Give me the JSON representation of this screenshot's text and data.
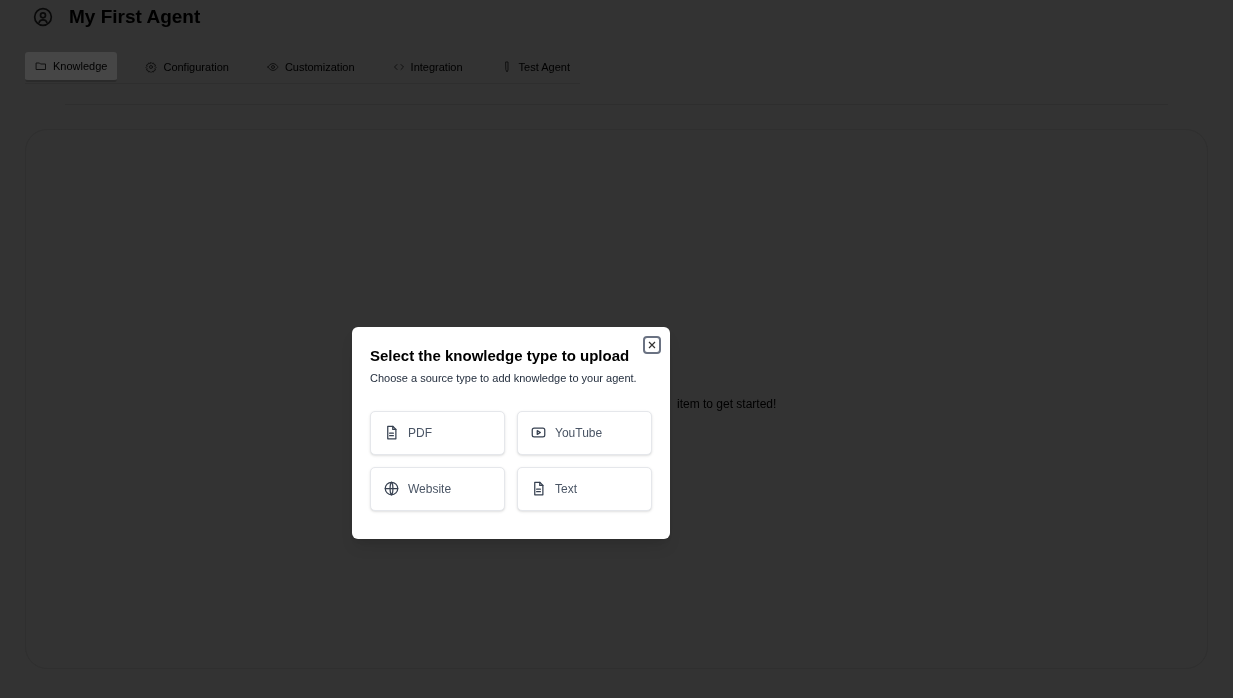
{
  "header": {
    "title": "My First Agent"
  },
  "tabs": [
    {
      "label": "Knowledge",
      "selected": true
    },
    {
      "label": "Configuration",
      "selected": false
    },
    {
      "label": "Customization",
      "selected": false
    },
    {
      "label": "Integration",
      "selected": false
    },
    {
      "label": "Test Agent",
      "selected": false
    }
  ],
  "empty_state": {
    "message": "item to get started!"
  },
  "dialog": {
    "title": "Select the knowledge type to upload",
    "description": "Choose a source type to add knowledge to your agent.",
    "options": [
      {
        "label": "PDF"
      },
      {
        "label": "YouTube"
      },
      {
        "label": "Website"
      },
      {
        "label": "Text"
      }
    ]
  }
}
